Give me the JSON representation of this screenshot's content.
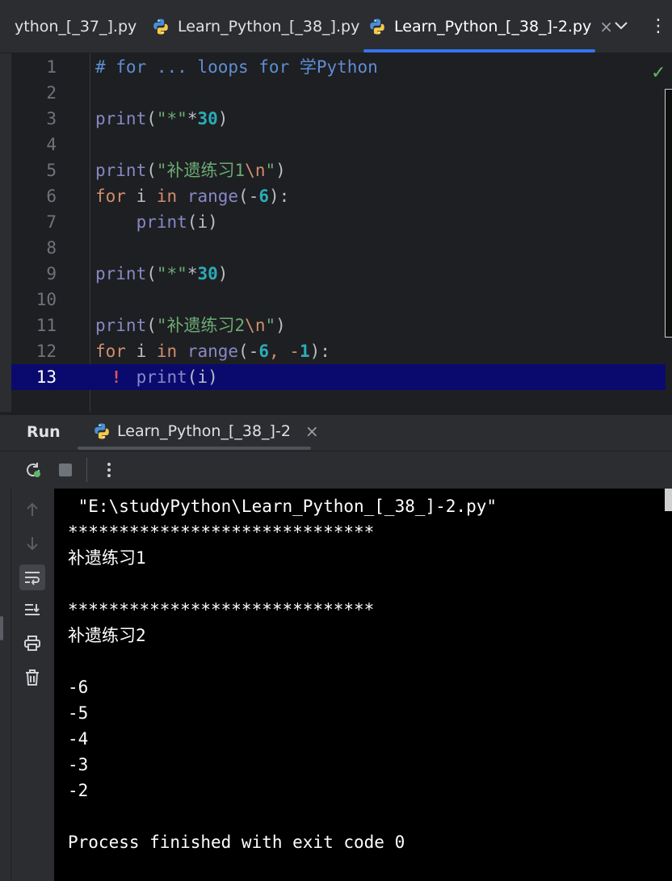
{
  "tabs": [
    {
      "label": "ython_[_37_].py",
      "active": false
    },
    {
      "label": "Learn_Python_[_38_].py",
      "active": false
    },
    {
      "label": "Learn_Python_[_38_]-2.py",
      "active": true
    }
  ],
  "tab_controls": {
    "close": "×",
    "dropdown": "⌵",
    "more": "⋮"
  },
  "editor": {
    "status_icon": "check-icon",
    "current_line": 13,
    "line_numbers": [
      "1",
      "2",
      "3",
      "4",
      "5",
      "6",
      "7",
      "8",
      "9",
      "10",
      "11",
      "12",
      "13"
    ],
    "lines": [
      [
        {
          "t": "# for ... loops for ",
          "c": "cmt-blue"
        },
        {
          "t": "学Python",
          "c": "cmt-blue"
        }
      ],
      [],
      [
        {
          "t": "print",
          "c": "fn"
        },
        {
          "t": "(",
          "c": "plain"
        },
        {
          "t": "\"*\"",
          "c": "str"
        },
        {
          "t": "*",
          "c": "plain"
        },
        {
          "t": "30",
          "c": "num-b"
        },
        {
          "t": ")",
          "c": "plain"
        }
      ],
      [],
      [
        {
          "t": "print",
          "c": "fn"
        },
        {
          "t": "(",
          "c": "plain"
        },
        {
          "t": "\"补遗练习1",
          "c": "str"
        },
        {
          "t": "\\n",
          "c": "esc"
        },
        {
          "t": "\"",
          "c": "str"
        },
        {
          "t": ")",
          "c": "plain"
        }
      ],
      [
        {
          "t": "for",
          "c": "kw"
        },
        {
          "t": " i ",
          "c": "plain"
        },
        {
          "t": "in",
          "c": "kw"
        },
        {
          "t": " ",
          "c": "plain"
        },
        {
          "t": "range",
          "c": "fn"
        },
        {
          "t": "(-",
          "c": "plain"
        },
        {
          "t": "6",
          "c": "num-b"
        },
        {
          "t": "):",
          "c": "plain"
        }
      ],
      [
        {
          "t": "    ",
          "c": "plain"
        },
        {
          "t": "print",
          "c": "fn"
        },
        {
          "t": "(i)",
          "c": "plain"
        }
      ],
      [],
      [
        {
          "t": "print",
          "c": "fn"
        },
        {
          "t": "(",
          "c": "plain"
        },
        {
          "t": "\"*\"",
          "c": "str"
        },
        {
          "t": "*",
          "c": "plain"
        },
        {
          "t": "30",
          "c": "num-b"
        },
        {
          "t": ")",
          "c": "plain"
        }
      ],
      [],
      [
        {
          "t": "print",
          "c": "fn"
        },
        {
          "t": "(",
          "c": "plain"
        },
        {
          "t": "\"补遗练习2",
          "c": "str"
        },
        {
          "t": "\\n",
          "c": "esc"
        },
        {
          "t": "\"",
          "c": "str"
        },
        {
          "t": ")",
          "c": "plain"
        }
      ],
      [
        {
          "t": "for",
          "c": "kw"
        },
        {
          "t": " i ",
          "c": "plain"
        },
        {
          "t": "in",
          "c": "kw"
        },
        {
          "t": " ",
          "c": "plain"
        },
        {
          "t": "range",
          "c": "fn"
        },
        {
          "t": "(-",
          "c": "plain"
        },
        {
          "t": "6",
          "c": "num-b"
        },
        {
          "t": ", -",
          "c": "kw"
        },
        {
          "t": "1",
          "c": "num-b"
        },
        {
          "t": "):",
          "c": "plain"
        }
      ],
      [
        {
          "t": "    ",
          "c": "plain"
        },
        {
          "t": "print",
          "c": "fn"
        },
        {
          "t": "(i)",
          "c": "plain"
        }
      ]
    ]
  },
  "run_panel": {
    "title": "Run",
    "tab_label": "Learn_Python_[_38_]-2",
    "tab_close": "×",
    "toolbar_icons": [
      "rerun-icon",
      "stop-icon",
      "more-icon"
    ],
    "side_icons": [
      "up-arrow-icon",
      "down-arrow-icon",
      "soft-wrap-icon",
      "scroll-to-end-icon",
      "print-icon",
      "trash-icon"
    ]
  },
  "console": {
    "lines": [
      " \"E:\\studyPython\\Learn_Python_[_38_]-2.py\"",
      "******************************",
      "补遗练习1",
      "",
      "******************************",
      "补遗练习2",
      "",
      "-6",
      "-5",
      "-4",
      "-3",
      "-2",
      "",
      "Process finished with exit code 0"
    ]
  },
  "colors": {
    "accent": "#3574f0",
    "current_line_bg": "#0a0a6e",
    "success": "#5fb865",
    "error": "#e05555"
  }
}
